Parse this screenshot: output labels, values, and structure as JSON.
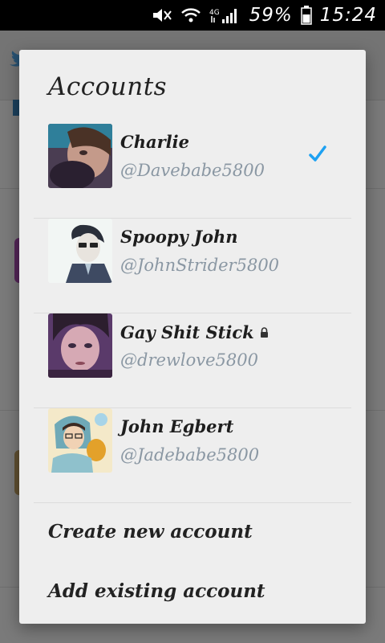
{
  "status_bar": {
    "battery_percent": "59%",
    "time": "15:24",
    "icons": [
      "mute-icon",
      "wifi-icon",
      "4g-signal-icon",
      "battery-icon"
    ]
  },
  "dialog": {
    "title": "Accounts",
    "accounts": [
      {
        "name": "Charlie",
        "handle": "@Davebabe5800",
        "selected": true,
        "locked": false,
        "avatar": "avatar-charlie"
      },
      {
        "name": "Spoopy John",
        "handle": "@JohnStrider5800",
        "selected": false,
        "locked": false,
        "avatar": "avatar-spoopy-john"
      },
      {
        "name": "Gay Shit Stick",
        "handle": "@drewlove5800",
        "selected": false,
        "locked": true,
        "avatar": "avatar-gay-shit-stick"
      },
      {
        "name": "John Egbert",
        "handle": "@Jadebabe5800",
        "selected": false,
        "locked": false,
        "avatar": "avatar-john-egbert"
      }
    ],
    "actions": {
      "create": "Create new account",
      "add_existing": "Add existing account"
    }
  },
  "colors": {
    "accent": "#1da1f2",
    "handle": "#8a97a3",
    "dialog_bg": "#eeeeee"
  }
}
